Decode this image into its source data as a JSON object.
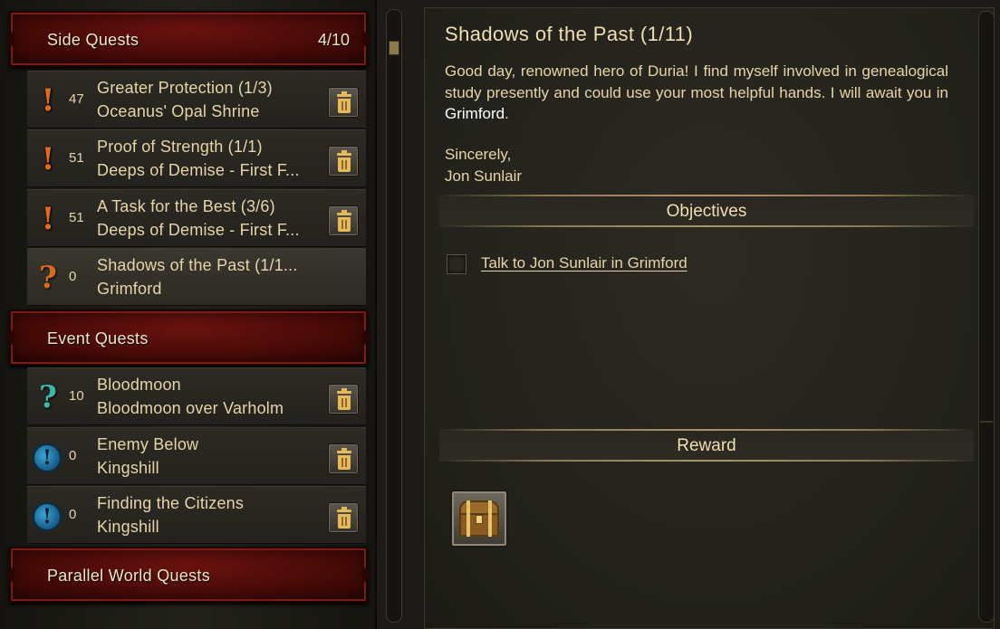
{
  "side_quests": {
    "label": "Side Quests",
    "count": "4/10",
    "items": [
      {
        "icon": "exclamation-icon",
        "level": "47",
        "name": "Greater Protection (1/3)",
        "location": "Oceanus' Opal Shrine"
      },
      {
        "icon": "exclamation-icon",
        "level": "51",
        "name": "Proof of Strength (1/1)",
        "location": "Deeps of Demise - First F..."
      },
      {
        "icon": "exclamation-icon",
        "level": "51",
        "name": "A Task for the Best (3/6)",
        "location": "Deeps of Demise - First F..."
      },
      {
        "icon": "question-mark-icon",
        "level": "0",
        "name": "Shadows of the Past (1/1...",
        "location": "Grimford"
      }
    ]
  },
  "event_quests": {
    "label": "Event Quests",
    "items": [
      {
        "icon": "teal-question-mark-icon",
        "level": "10",
        "name": "Bloodmoon",
        "location": "Bloodmoon over Varholm"
      },
      {
        "icon": "event-exclamation-icon",
        "level": "0",
        "name": "Enemy Below",
        "location": "Kingshill"
      },
      {
        "icon": "event-exclamation-icon",
        "level": "0",
        "name": "Finding the Citizens",
        "location": "Kingshill"
      }
    ]
  },
  "parallel_world_quests": {
    "label": "Parallel World Quests"
  },
  "detail": {
    "title": "Shadows of the Past (1/11)",
    "body_start": "Good day, renowned hero of Duria! I find myself involved in genealogical study presently and could use your most helpful hands. I will await you in ",
    "body_highlight": "Grimford",
    "body_end": ".",
    "signoff_1": "Sincerely,",
    "signoff_2": "Jon Sunlair",
    "objectives_label": "Objectives",
    "objective_1": "Talk to Jon Sunlair in Grimford",
    "reward_label": "Reward",
    "reward_icon": "treasure-chest-icon"
  },
  "colors": {
    "accent_red": "#6b130f",
    "text": "#e7d5a9",
    "highlight": "#ffffff",
    "excl_orange": "#e46a19",
    "teal": "#3ab7a8"
  }
}
